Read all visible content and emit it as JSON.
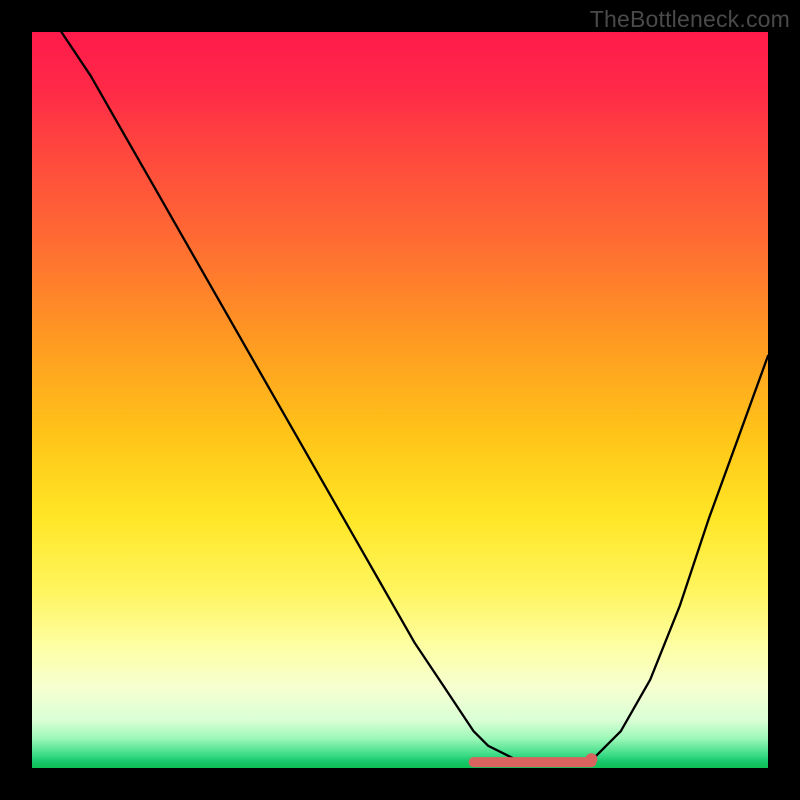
{
  "watermark": "TheBottleneck.com",
  "chart_data": {
    "type": "line",
    "title": "",
    "xlabel": "",
    "ylabel": "",
    "xlim": [
      0,
      100
    ],
    "ylim": [
      0,
      100
    ],
    "series": [
      {
        "name": "curve",
        "x": [
          4,
          8,
          12,
          16,
          20,
          24,
          28,
          32,
          36,
          40,
          44,
          48,
          52,
          56,
          60,
          62,
          66,
          70,
          74,
          76,
          80,
          84,
          88,
          92,
          96,
          100
        ],
        "y": [
          100,
          94,
          87,
          80,
          73,
          66,
          59,
          52,
          45,
          38,
          31,
          24,
          17,
          11,
          5,
          3,
          1,
          0.5,
          0.5,
          1,
          5,
          12,
          22,
          34,
          45,
          56
        ]
      }
    ],
    "flat_segment": {
      "x_start": 60,
      "x_end": 76,
      "y": 0.8
    },
    "marker": {
      "x": 76,
      "y": 1.2
    },
    "colors": {
      "curve": "#000000",
      "flat_segment": "#d8635f",
      "marker": "#d8635f"
    }
  }
}
